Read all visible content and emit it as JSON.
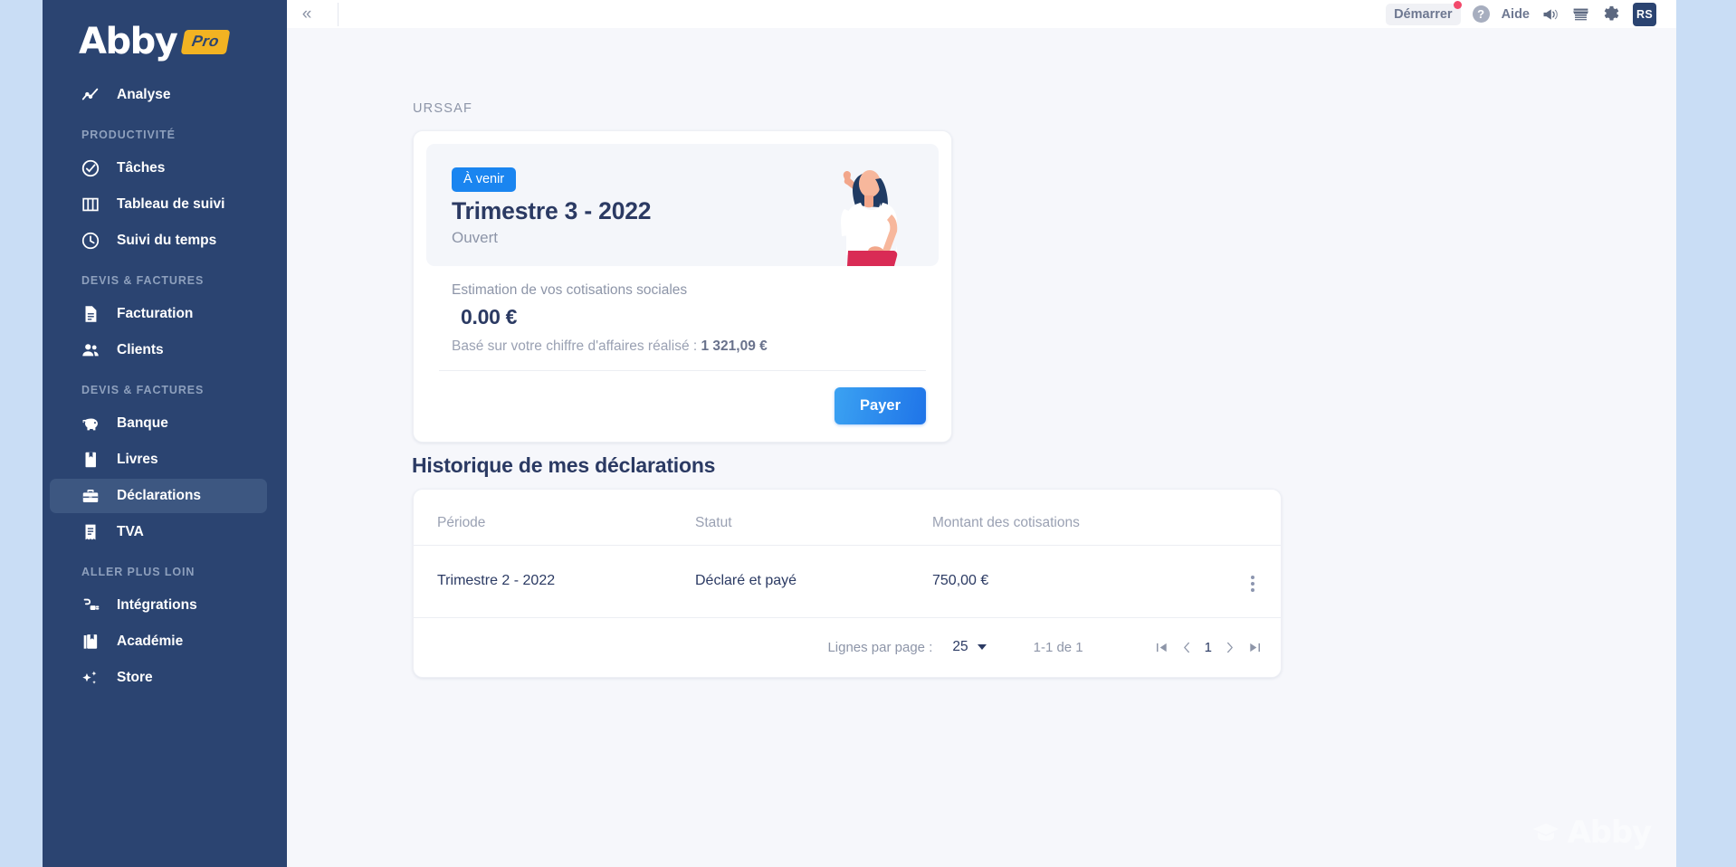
{
  "sidebar": {
    "logo": {
      "name": "Abb",
      "accent": "y",
      "badge": "Pro"
    },
    "groups": [
      {
        "header": null,
        "items": [
          {
            "label": "Analyse",
            "icon": "analytics-icon",
            "active": false
          }
        ]
      },
      {
        "header": "PRODUCTIVITÉ",
        "items": [
          {
            "label": "Tâches",
            "icon": "check-circle-icon",
            "active": false
          },
          {
            "label": "Tableau de suivi",
            "icon": "kanban-icon",
            "active": false
          },
          {
            "label": "Suivi du temps",
            "icon": "clock-icon",
            "active": false
          }
        ]
      },
      {
        "header": "DEVIS & FACTURES",
        "items": [
          {
            "label": "Facturation",
            "icon": "document-icon",
            "active": false
          },
          {
            "label": "Clients",
            "icon": "people-icon",
            "active": false
          }
        ]
      },
      {
        "header": "DEVIS & FACTURES",
        "items": [
          {
            "label": "Banque",
            "icon": "piggy-bank-icon",
            "active": false
          },
          {
            "label": "Livres",
            "icon": "book-icon",
            "active": false
          },
          {
            "label": "Déclarations",
            "icon": "briefcase-icon",
            "active": true
          },
          {
            "label": "TVA",
            "icon": "receipt-icon",
            "active": false
          }
        ]
      },
      {
        "header": "ALLER PLUS LOIN",
        "items": [
          {
            "label": "Intégrations",
            "icon": "plug-icon",
            "active": false
          },
          {
            "label": "Académie",
            "icon": "graduation-book-icon",
            "active": false
          },
          {
            "label": "Store",
            "icon": "sparkles-icon",
            "active": false
          }
        ]
      }
    ]
  },
  "topbar": {
    "collapse_icon": "double-chevron-left-icon",
    "start_label": "Démarrer",
    "help_icon_label": "?",
    "aide_label": "Aide",
    "megaphone_icon": "megaphone-icon",
    "store_icon": "storefront-icon",
    "settings_icon": "gear-icon",
    "avatar_initials": "RS"
  },
  "main": {
    "section_label": "URSSAF",
    "card": {
      "badge": "À venir",
      "title": "Trimestre 3 - 2022",
      "subtitle": "Ouvert",
      "estimation_label": "Estimation de vos cotisations sociales",
      "estimation_amount": "0.00 €",
      "base_prefix": "Basé sur votre chiffre d'affaires réalisé : ",
      "base_amount": "1 321,09 €",
      "pay_label": "Payer"
    },
    "history": {
      "title": "Historique de mes déclarations",
      "columns": [
        "Période",
        "Statut",
        "Montant des cotisations"
      ],
      "rows": [
        {
          "periode": "Trimestre 2 - 2022",
          "statut": "Déclaré et payé",
          "montant": "750,00 €",
          "menu_icon": "more-vertical-icon"
        }
      ],
      "pagination": {
        "rows_per_page_label": "Lignes par page :",
        "rows_per_page_value": "25",
        "range": "1-1 de 1",
        "first_icon": "first-page-icon",
        "prev_icon": "chevron-left-icon",
        "page": "1",
        "next_icon": "chevron-right-icon",
        "last_icon": "last-page-icon"
      }
    },
    "watermark": "Abby"
  },
  "colors": {
    "sidebar_bg": "#2b4471",
    "accent_blue": "#1a85f0",
    "badge_yellow": "#f2b322",
    "page_bg": "#c9ddf5",
    "text_dark": "#2b3a63"
  }
}
